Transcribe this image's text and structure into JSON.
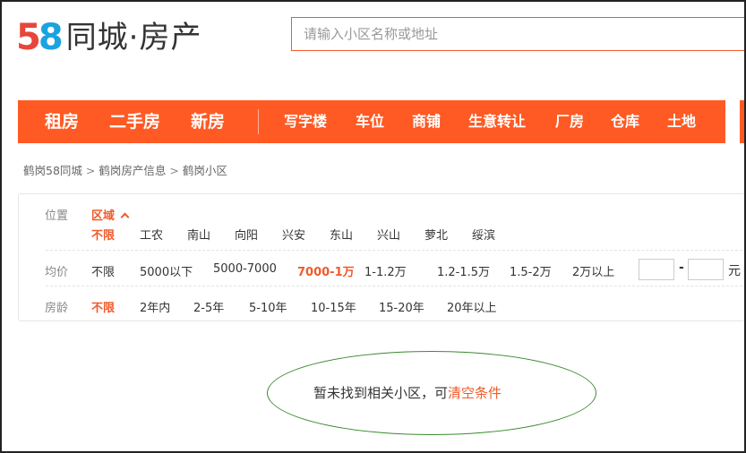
{
  "header": {
    "logo_number_5": "5",
    "logo_number_8": "8",
    "logo_text": "同城·房产",
    "search_placeholder": "请输入小区名称或地址"
  },
  "nav": {
    "main_items": [
      "租房",
      "二手房",
      "新房"
    ],
    "sub_items": [
      "写字楼",
      "车位",
      "商铺",
      "生意转让",
      "厂房",
      "仓库",
      "土地"
    ]
  },
  "breadcrumb": {
    "items": [
      "鹤岗58同城",
      "鹤岗房产信息",
      "鹤岗小区"
    ],
    "separator": ">"
  },
  "filters": {
    "location": {
      "label": "位置",
      "toggle_label": "区域",
      "options": [
        "不限",
        "工农",
        "南山",
        "向阳",
        "兴安",
        "东山",
        "兴山",
        "萝北",
        "绥滨"
      ],
      "selected": "不限"
    },
    "price": {
      "label": "均价",
      "options": [
        "不限",
        "5000以下",
        "5000-7000",
        "7000-1万",
        "1-1.2万",
        "1.2-1.5万",
        "1.5-2万",
        "2万以上"
      ],
      "selected": "7000-1万",
      "min_value": "",
      "max_value": "",
      "range_separator": "-",
      "unit": "元"
    },
    "age": {
      "label": "房龄",
      "options": [
        "不限",
        "2年内",
        "2-5年",
        "5-10年",
        "10-15年",
        "15-20年",
        "20年以上"
      ],
      "selected": "不限"
    }
  },
  "empty_state": {
    "message": "暂未找到相关小区，可",
    "clear_link": "清空条件"
  },
  "colors": {
    "accent": "#f05a2a",
    "nav_bg": "#ff5a24",
    "annotation_ellipse": "#3a8a2e"
  }
}
